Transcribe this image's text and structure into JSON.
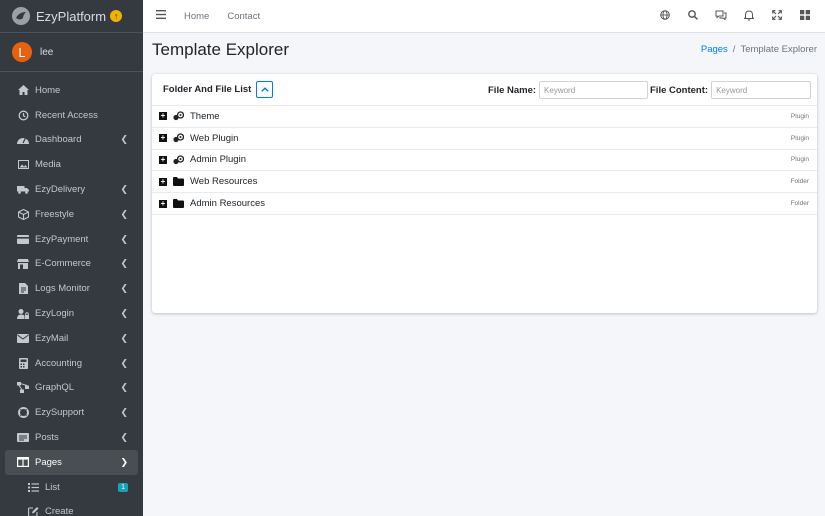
{
  "brand": {
    "name": "EzyPlatform",
    "logo_icon": "dove-logo-icon",
    "badge_icon": "up-arrow-circle-icon"
  },
  "user": {
    "initial": "L",
    "name": "lee"
  },
  "sidebar": {
    "items": [
      {
        "label": "Home",
        "icon": "home-icon",
        "chevron": false
      },
      {
        "label": "Recent Access",
        "icon": "history-icon",
        "chevron": false
      },
      {
        "label": "Dashboard",
        "icon": "tachometer-icon",
        "chevron": true
      },
      {
        "label": "Media",
        "icon": "image-icon",
        "chevron": false
      },
      {
        "label": "EzyDelivery",
        "icon": "truck-icon",
        "chevron": true
      },
      {
        "label": "Freestyle",
        "icon": "cube-icon",
        "chevron": true
      },
      {
        "label": "EzyPayment",
        "icon": "credit-card-icon",
        "chevron": true
      },
      {
        "label": "E-Commerce",
        "icon": "store-icon",
        "chevron": true
      },
      {
        "label": "Logs Monitor",
        "icon": "file-log-icon",
        "chevron": true
      },
      {
        "label": "EzyLogin",
        "icon": "user-lock-icon",
        "chevron": true
      },
      {
        "label": "EzyMail",
        "icon": "envelope-icon",
        "chevron": true
      },
      {
        "label": "Accounting",
        "icon": "calculator-icon",
        "chevron": true
      },
      {
        "label": "GraphQL",
        "icon": "graph-icon",
        "chevron": true
      },
      {
        "label": "EzySupport",
        "icon": "lifebuoy-icon",
        "chevron": true
      },
      {
        "label": "Posts",
        "icon": "posts-icon",
        "chevron": true
      },
      {
        "label": "Pages",
        "icon": "columns-icon",
        "chevron": "down",
        "active": true
      }
    ],
    "sub_items": [
      {
        "label": "List",
        "icon": "list-icon",
        "badge": "1"
      },
      {
        "label": "Create",
        "icon": "edit-icon"
      }
    ]
  },
  "topbar": {
    "links": [
      "Home",
      "Contact"
    ],
    "icons": [
      "globe-icon",
      "search-icon",
      "comments-icon",
      "bell-icon",
      "expand-icon",
      "grid-icon"
    ]
  },
  "header": {
    "title": "Template Explorer",
    "breadcrumb": {
      "link": "Pages",
      "current": "Template Explorer"
    }
  },
  "card": {
    "title": "Folder And File List",
    "file_name_label": "File Name:",
    "file_name_placeholder": "Keyword",
    "file_content_label": "File Content:",
    "file_content_placeholder": "Keyword",
    "rows": [
      {
        "name": "Theme",
        "type": "Plugin",
        "icon": "plugin-icon"
      },
      {
        "name": "Web Plugin",
        "type": "Plugin",
        "icon": "plugin-icon"
      },
      {
        "name": "Admin Plugin",
        "type": "Plugin",
        "icon": "plugin-icon"
      },
      {
        "name": "Web Resources",
        "type": "Folder",
        "icon": "folder-icon"
      },
      {
        "name": "Admin Resources",
        "type": "Folder",
        "icon": "folder-icon"
      }
    ]
  },
  "colors": {
    "sidebar_bg": "#343a40",
    "accent": "#007bff",
    "avatar": "#e8610e",
    "badge": "#17a2b8"
  }
}
